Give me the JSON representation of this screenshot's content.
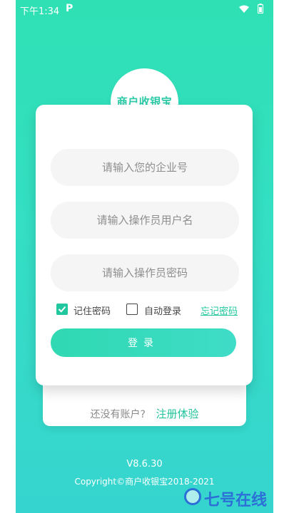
{
  "status_bar": {
    "time": "下午1:34",
    "app_indicator": "P",
    "icons": [
      "wifi-icon",
      "battery-icon"
    ]
  },
  "logo": {
    "text": "商户收银宝"
  },
  "form": {
    "company_placeholder": "请输入您的企业号",
    "username_placeholder": "请输入操作员用户名",
    "password_placeholder": "请输入操作员密码",
    "remember_label": "记住密码",
    "remember_checked": true,
    "autologin_label": "自动登录",
    "autologin_checked": false,
    "forgot_link": "忘记密码",
    "login_button": "登录"
  },
  "register": {
    "question": "还没有账户?",
    "link": "注册体验"
  },
  "footer": {
    "version": "V8.6.30",
    "copyright": "Copyright©商户收银宝2018-2021"
  },
  "watermark": {
    "text": "七号在线"
  },
  "colors": {
    "accent": "#21c79f",
    "background_top": "#2fe0b4",
    "background_bottom": "#36d4cf",
    "watermark": "#2c6fd6"
  }
}
